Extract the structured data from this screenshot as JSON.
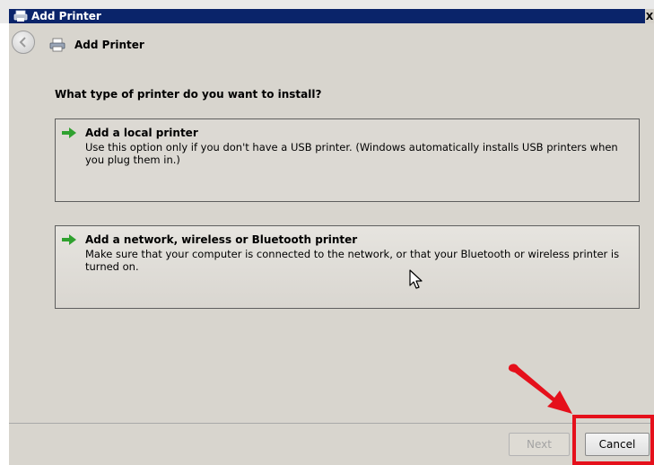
{
  "window": {
    "title": "Add Printer",
    "close_glyph": "X"
  },
  "nav": {
    "title": "Add Printer"
  },
  "main": {
    "heading": "What type of printer do you want to install?",
    "options": [
      {
        "title": "Add a local printer",
        "description": "Use this option only if you don't have a USB printer. (Windows automatically installs USB printers when you plug them in.)",
        "icon": "green-arrow-icon"
      },
      {
        "title": "Add a network, wireless or Bluetooth printer",
        "description": "Make sure that your computer is connected to the network, or that your Bluetooth or wireless printer is turned on.",
        "icon": "green-arrow-icon"
      }
    ]
  },
  "footer": {
    "next_label": "Next",
    "cancel_label": "Cancel"
  },
  "colors": {
    "titlebar": "#0a246a",
    "dialog_bg": "#d8d5ce",
    "option_arrow": "#2fa12f",
    "annotation": "#e5101b"
  }
}
